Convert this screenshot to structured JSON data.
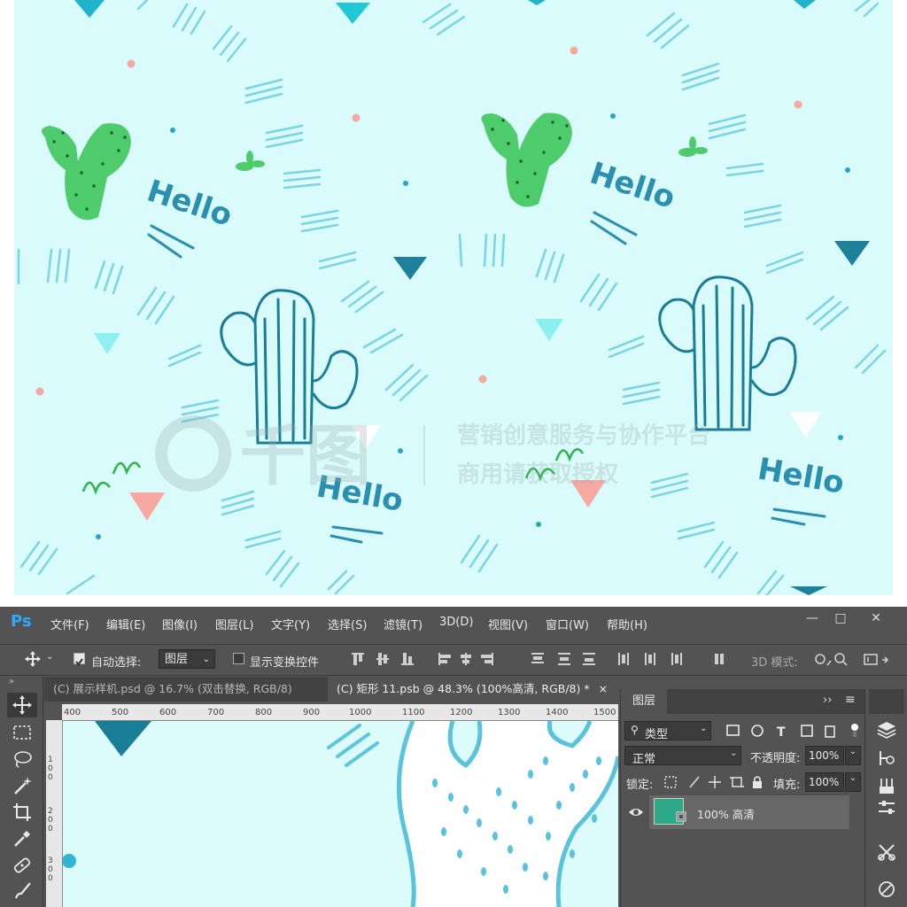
{
  "preview": {
    "hello_text": "Hello",
    "watermark_line1": "营销创意服务与协作平台",
    "watermark_line2": "商用请获取授权",
    "watermark_logo_text": "千图",
    "bg_color": "#d9fbfb"
  },
  "app": {
    "logo": "Ps",
    "menu": [
      "文件(F)",
      "编辑(E)",
      "图像(I)",
      "图层(L)",
      "文字(Y)",
      "选择(S)",
      "滤镜(T)",
      "3D(D)",
      "视图(V)",
      "窗口(W)",
      "帮助(H)"
    ],
    "window_buttons": [
      "—",
      "□",
      "✕"
    ]
  },
  "options": {
    "auto_select_label": "自动选择:",
    "auto_select_value": "图层",
    "show_transform_label": "显示变换控件",
    "mode_3d_label": "3D 模式:"
  },
  "tabs": [
    {
      "label": "(C) 展示样机.psd @ 16.7% (双击替换, RGB/8)",
      "close": "×",
      "active": false
    },
    {
      "label": "(C) 矩形 11.psb @ 48.3% (100%高清, RGB/8) *",
      "close": "×",
      "active": true
    }
  ],
  "ruler": {
    "h_ticks": [
      "400",
      "500",
      "600",
      "700",
      "800",
      "900",
      "1000",
      "1100",
      "1200",
      "1300",
      "1400",
      "1500"
    ],
    "v_ticks": [
      "100",
      "200",
      "300"
    ]
  },
  "layers_panel": {
    "title": "图层",
    "filter_label": "类型",
    "blend_mode": "正常",
    "opacity_label": "不透明度:",
    "opacity_value": "100%",
    "lock_label": "锁定:",
    "fill_label": "填充:",
    "fill_value": "100%",
    "layer_name": "100% 高清",
    "layer_thumb_color": "#2ea889"
  },
  "colors": {
    "accent_blue": "#31a8ff",
    "teal_dark": "#1f7f98",
    "cactus_green": "#4ecb6a",
    "pink": "#f7a8a0"
  }
}
